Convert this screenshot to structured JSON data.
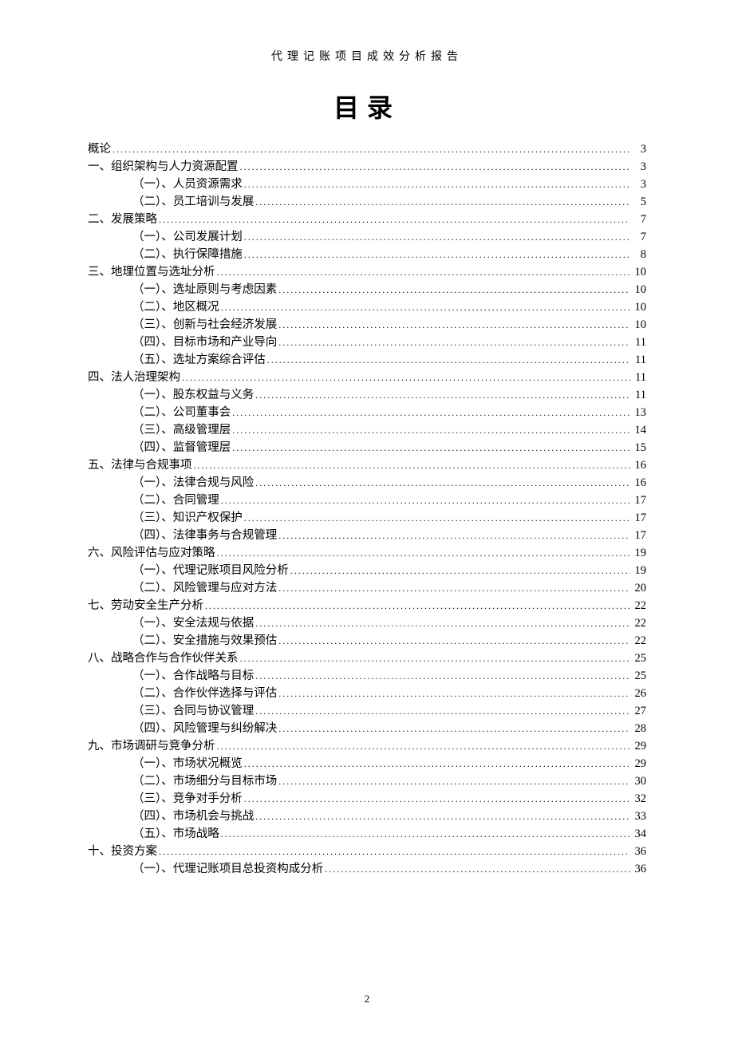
{
  "header": "代理记账项目成效分析报告",
  "title": "目录",
  "page_number": "2",
  "toc": [
    {
      "level": 1,
      "label": "概论",
      "page": "3"
    },
    {
      "level": 1,
      "label": "一、组织架构与人力资源配置",
      "page": "3"
    },
    {
      "level": 2,
      "label": "（一）、人员资源需求",
      "page": "3"
    },
    {
      "level": 2,
      "label": "（二）、员工培训与发展",
      "page": "5"
    },
    {
      "level": 1,
      "label": "二、发展策略",
      "page": "7"
    },
    {
      "level": 2,
      "label": "（一）、公司发展计划",
      "page": "7"
    },
    {
      "level": 2,
      "label": "（二）、执行保障措施",
      "page": "8"
    },
    {
      "level": 1,
      "label": "三、地理位置与选址分析",
      "page": "10"
    },
    {
      "level": 2,
      "label": "（一）、选址原则与考虑因素",
      "page": "10"
    },
    {
      "level": 2,
      "label": "（二）、地区概况",
      "page": "10"
    },
    {
      "level": 2,
      "label": "（三）、创新与社会经济发展",
      "page": "10"
    },
    {
      "level": 2,
      "label": "（四）、目标市场和产业导向",
      "page": "11"
    },
    {
      "level": 2,
      "label": "（五）、选址方案综合评估",
      "page": "11"
    },
    {
      "level": 1,
      "label": "四、法人治理架构",
      "page": "11"
    },
    {
      "level": 2,
      "label": "（一）、股东权益与义务",
      "page": "11"
    },
    {
      "level": 2,
      "label": "（二）、公司董事会",
      "page": "13"
    },
    {
      "level": 2,
      "label": "（三）、高级管理层",
      "page": "14"
    },
    {
      "level": 2,
      "label": "（四）、监督管理层",
      "page": "15"
    },
    {
      "level": 1,
      "label": "五、法律与合规事项",
      "page": "16"
    },
    {
      "level": 2,
      "label": "（一）、法律合规与风险",
      "page": "16"
    },
    {
      "level": 2,
      "label": "（二）、合同管理",
      "page": "17"
    },
    {
      "level": 2,
      "label": "（三）、知识产权保护",
      "page": "17"
    },
    {
      "level": 2,
      "label": "（四）、法律事务与合规管理",
      "page": "17"
    },
    {
      "level": 1,
      "label": "六、风险评估与应对策略",
      "page": "19"
    },
    {
      "level": 2,
      "label": "（一）、代理记账项目风险分析",
      "page": "19"
    },
    {
      "level": 2,
      "label": "（二）、风险管理与应对方法",
      "page": "20"
    },
    {
      "level": 1,
      "label": "七、劳动安全生产分析",
      "page": "22"
    },
    {
      "level": 2,
      "label": "（一）、安全法规与依据",
      "page": "22"
    },
    {
      "level": 2,
      "label": "（二）、安全措施与效果预估",
      "page": "22"
    },
    {
      "level": 1,
      "label": "八、战略合作与合作伙伴关系",
      "page": "25"
    },
    {
      "level": 2,
      "label": "（一）、合作战略与目标",
      "page": "25"
    },
    {
      "level": 2,
      "label": "（二）、合作伙伴选择与评估",
      "page": "26"
    },
    {
      "level": 2,
      "label": "（三）、合同与协议管理",
      "page": "27"
    },
    {
      "level": 2,
      "label": "（四）、风险管理与纠纷解决",
      "page": "28"
    },
    {
      "level": 1,
      "label": "九、市场调研与竞争分析",
      "page": "29"
    },
    {
      "level": 2,
      "label": "（一）、市场状况概览",
      "page": "29"
    },
    {
      "level": 2,
      "label": "（二）、市场细分与目标市场",
      "page": "30"
    },
    {
      "level": 2,
      "label": "（三）、竞争对手分析",
      "page": "32"
    },
    {
      "level": 2,
      "label": "（四）、市场机会与挑战",
      "page": "33"
    },
    {
      "level": 2,
      "label": "（五）、市场战略",
      "page": "34"
    },
    {
      "level": 1,
      "label": "十、投资方案",
      "page": "36"
    },
    {
      "level": 2,
      "label": "（一）、代理记账项目总投资构成分析",
      "page": "36"
    }
  ]
}
